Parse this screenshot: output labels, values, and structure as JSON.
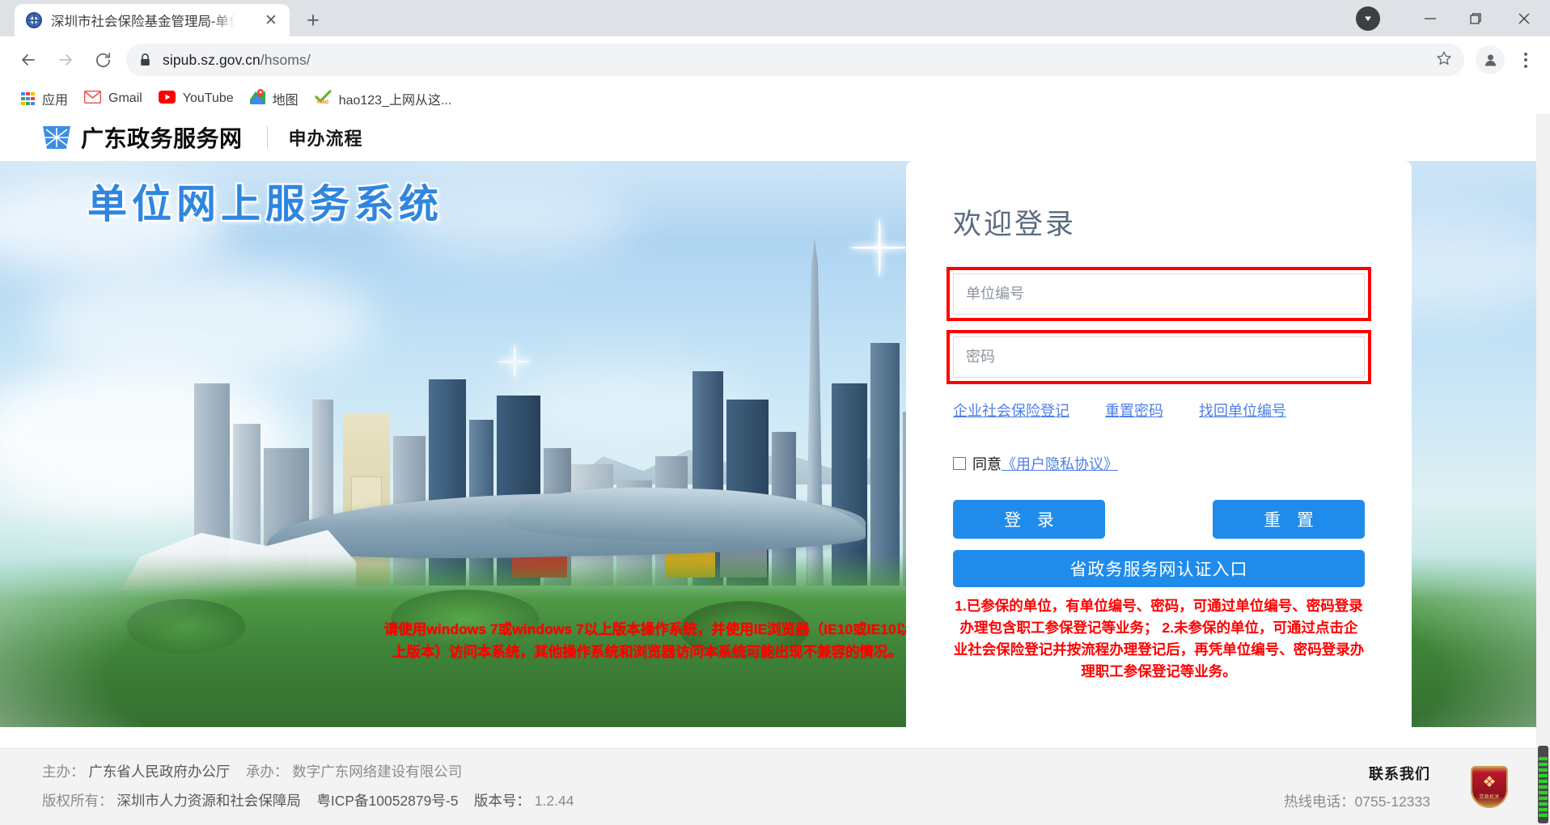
{
  "browser": {
    "tab": {
      "title": "深圳市社会保险基金管理局-单位",
      "favicon": "globe-icon",
      "close": "✕"
    },
    "newtab_label": "+",
    "window_controls": {
      "minimize": "—",
      "maximize": "❐",
      "close": "✕",
      "download_badge": "▼"
    },
    "nav": {
      "back": "←",
      "forward": "→",
      "reload": "⟳"
    },
    "omnibox": {
      "lock": "lock-icon",
      "url_domain": "sipub.sz.gov.cn",
      "url_path": "/hsoms/",
      "star": "☆"
    },
    "profile": "avatar-icon",
    "menu": "kebab-menu-icon",
    "bookmarks": [
      {
        "icon": "apps-grid-icon",
        "label": "应用"
      },
      {
        "icon": "gmail-icon",
        "label": "Gmail"
      },
      {
        "icon": "youtube-icon",
        "label": "YouTube"
      },
      {
        "icon": "maps-icon",
        "label": "地图"
      },
      {
        "icon": "hao123-icon",
        "label": "hao123_上网从这..."
      }
    ]
  },
  "site": {
    "header": {
      "logo": "guangdong-star-logo",
      "title": "广东政务服务网",
      "subtitle": "申办流程"
    },
    "banner": {
      "title": "单位网上服务系统",
      "warning": "请使用windows 7或windows 7以上版本操作系统，并使用IE浏览器（IE10或IE10以上版本）访问本系统，其他操作系统和浏览器访问本系统可能出现不兼容的情况。"
    },
    "login": {
      "heading": "欢迎登录",
      "unit_placeholder": "单位编号",
      "unit_value": "",
      "password_placeholder": "密码",
      "password_value": "",
      "links": [
        "企业社会保险登记",
        "重置密码",
        "找回单位编号"
      ],
      "agree_text": "同意",
      "agree_link": "《用户隐私协议》",
      "agree_checked": false,
      "login_button": "登 录",
      "reset_button": "重 置",
      "province_button": "省政务服务网认证入口",
      "notice": "1.已参保的单位，有单位编号、密码，可通过单位编号、密码登录办理包含职工参保登记等业务；\n2.未参保的单位，可通过点击企业社会保险登记并按流程办理登记后，再凭单位编号、密码登录办理职工参保登记等业务。"
    },
    "footer": {
      "line1_label": "主办：",
      "line1_value": "广东省人民政府办公厅",
      "line1b_label": "承办：",
      "line1b_value": "数字广东网络建设有限公司",
      "line2_label": "版权所有：",
      "line2_value": "深圳市人力资源和社会保障局",
      "icp": "粤ICP备10052879号-5",
      "version_label": "版本号：",
      "version_value": "1.2.44",
      "contact": "联系我们",
      "hotline": "热线电话：0755-12333",
      "badge": "police-shield-badge",
      "badge_text": "党政机关"
    }
  },
  "colors": {
    "accent_blue": "#1f8ceb",
    "link_blue": "#4d7fe8",
    "warning_red": "#fe0000",
    "annotation_red": "#fe0000"
  }
}
